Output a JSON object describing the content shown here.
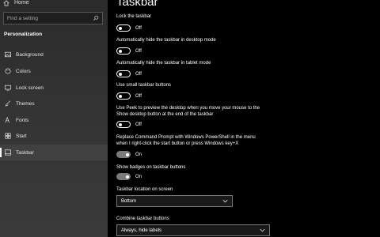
{
  "sidebar": {
    "home_label": "Home",
    "search_placeholder": "Find a setting",
    "section_title": "Personalization",
    "items": [
      {
        "label": "Background",
        "icon": "picture-icon"
      },
      {
        "label": "Colors",
        "icon": "palette-icon"
      },
      {
        "label": "Lock screen",
        "icon": "lock-screen-icon"
      },
      {
        "label": "Themes",
        "icon": "brush-icon"
      },
      {
        "label": "Fonts",
        "icon": "font-icon"
      },
      {
        "label": "Start",
        "icon": "start-icon"
      },
      {
        "label": "Taskbar",
        "icon": "taskbar-icon"
      }
    ]
  },
  "main": {
    "title": "Taskbar",
    "settings": [
      {
        "label": "Lock the taskbar",
        "state": "Off"
      },
      {
        "label": "Automatically hide the taskbar in desktop mode",
        "state": "Off"
      },
      {
        "label": "Automatically hide the taskbar in tablet mode",
        "state": "Off"
      },
      {
        "label": "Use small taskbar buttons",
        "state": "Off"
      },
      {
        "label_line1": "Use Peek to preview the desktop when you move your mouse to the",
        "label_line2": "Show desktop button at the end of the taskbar",
        "state": "Off"
      },
      {
        "label_line1": "Replace Command Prompt with Windows PowerShell in the menu",
        "label_line2": "when I right-click the start button or press Windows key+X",
        "state": "On"
      },
      {
        "label": "Show badges on taskbar buttons",
        "state": "On"
      }
    ],
    "location": {
      "label": "Taskbar location on screen",
      "value": "Bottom"
    },
    "combine": {
      "label": "Combine taskbar buttons",
      "value": "Always, hide labels"
    }
  },
  "colors": {
    "accent_on": "#7a7a7a",
    "background": "#000000",
    "sidebar": "#333333"
  }
}
